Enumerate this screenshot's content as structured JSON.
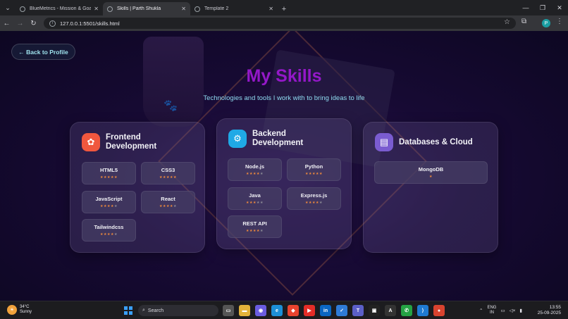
{
  "browser": {
    "tabs": [
      {
        "label": "BlueMetrics - Mission & Goals",
        "active": false
      },
      {
        "label": "Skills | Parth Shukla",
        "active": true
      },
      {
        "label": "Template 2",
        "active": false
      }
    ],
    "url": "127.0.0.1:5501/skills.html",
    "profile_initial": "P"
  },
  "page": {
    "back_label": "← Back to Profile",
    "title": "My Skills",
    "subtitle": "Technologies and tools I work with to bring ideas to life",
    "accent_title": "#9418c8",
    "accent_subtitle": "#8fdbf0",
    "cards": [
      {
        "title": "Frontend Development",
        "icon": "palette-icon",
        "icon_color": "#f0573e",
        "skills": [
          {
            "name": "HTML5",
            "rating": 5
          },
          {
            "name": "CSS3",
            "rating": 5
          },
          {
            "name": "JavaScript",
            "rating": 4
          },
          {
            "name": "React",
            "rating": 4
          },
          {
            "name": "Tailwindcss",
            "rating": 4
          }
        ]
      },
      {
        "title": "Backend Development",
        "icon": "gear-icon",
        "icon_color": "#1fa9e6",
        "skills": [
          {
            "name": "Node.js",
            "rating": 4
          },
          {
            "name": "Python",
            "rating": 5
          },
          {
            "name": "Java",
            "rating": 3
          },
          {
            "name": "Express.js",
            "rating": 4
          },
          {
            "name": "REST API",
            "rating": 4
          }
        ]
      },
      {
        "title": "Databases & Cloud",
        "icon": "database-icon",
        "icon_color": "#7a5cd0",
        "skills": [
          {
            "name": "MongoDB",
            "rating": 1
          }
        ]
      }
    ]
  },
  "taskbar": {
    "weather_temp": "34°C",
    "weather_desc": "Sunny",
    "search_label": "Search",
    "lang_line1": "ENG",
    "lang_line2": "IN",
    "time": "13:55",
    "date": "25-09-2025"
  }
}
